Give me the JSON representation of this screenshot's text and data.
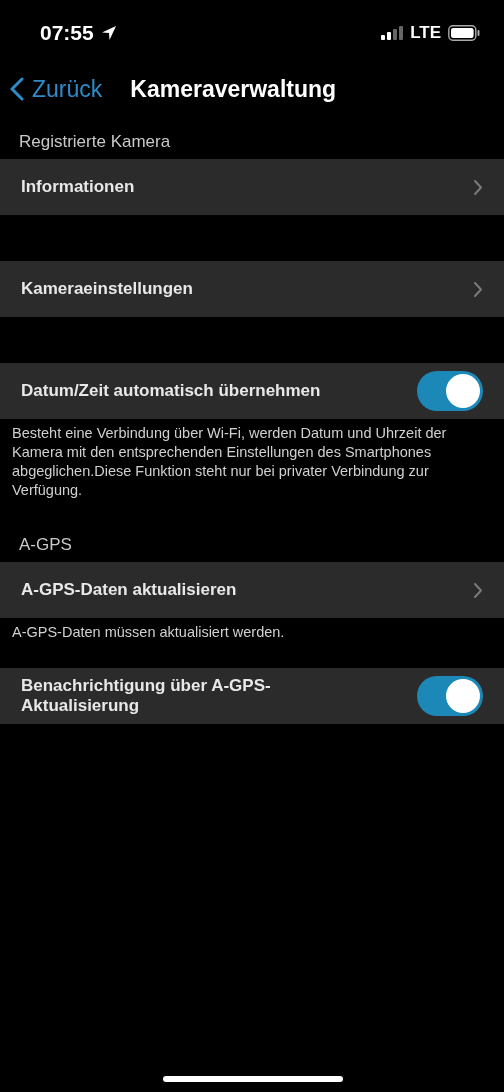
{
  "status_bar": {
    "time": "07:55",
    "network": "LTE"
  },
  "nav": {
    "back": "Zurück",
    "title": "Kameraverwaltung"
  },
  "sections": [
    {
      "header": "Registrierte Kamera",
      "rows": [
        {
          "kind": "link",
          "label": "Informationen"
        }
      ]
    },
    {
      "rows": [
        {
          "kind": "link",
          "label": "Kameraeinstellungen"
        }
      ]
    },
    {
      "rows": [
        {
          "kind": "toggle",
          "label": "Datum/Zeit automatisch übernehmen",
          "on": true
        }
      ],
      "footer": "Besteht eine Verbindung über Wi-Fi, werden Datum und Uhrzeit der Kamera mit den entsprechenden Einstellungen des Smartphones abgeglichen.Diese Funktion steht nur bei privater Verbindung zur Verfügung."
    },
    {
      "header": "A-GPS",
      "rows": [
        {
          "kind": "link",
          "label": "A-GPS-Daten aktualisieren"
        }
      ],
      "footer": "A-GPS-Daten müssen aktualisiert werden."
    },
    {
      "rows": [
        {
          "kind": "toggle",
          "label": "Benachrichtigung über A-GPS-Aktualisierung",
          "on": true
        }
      ]
    }
  ]
}
